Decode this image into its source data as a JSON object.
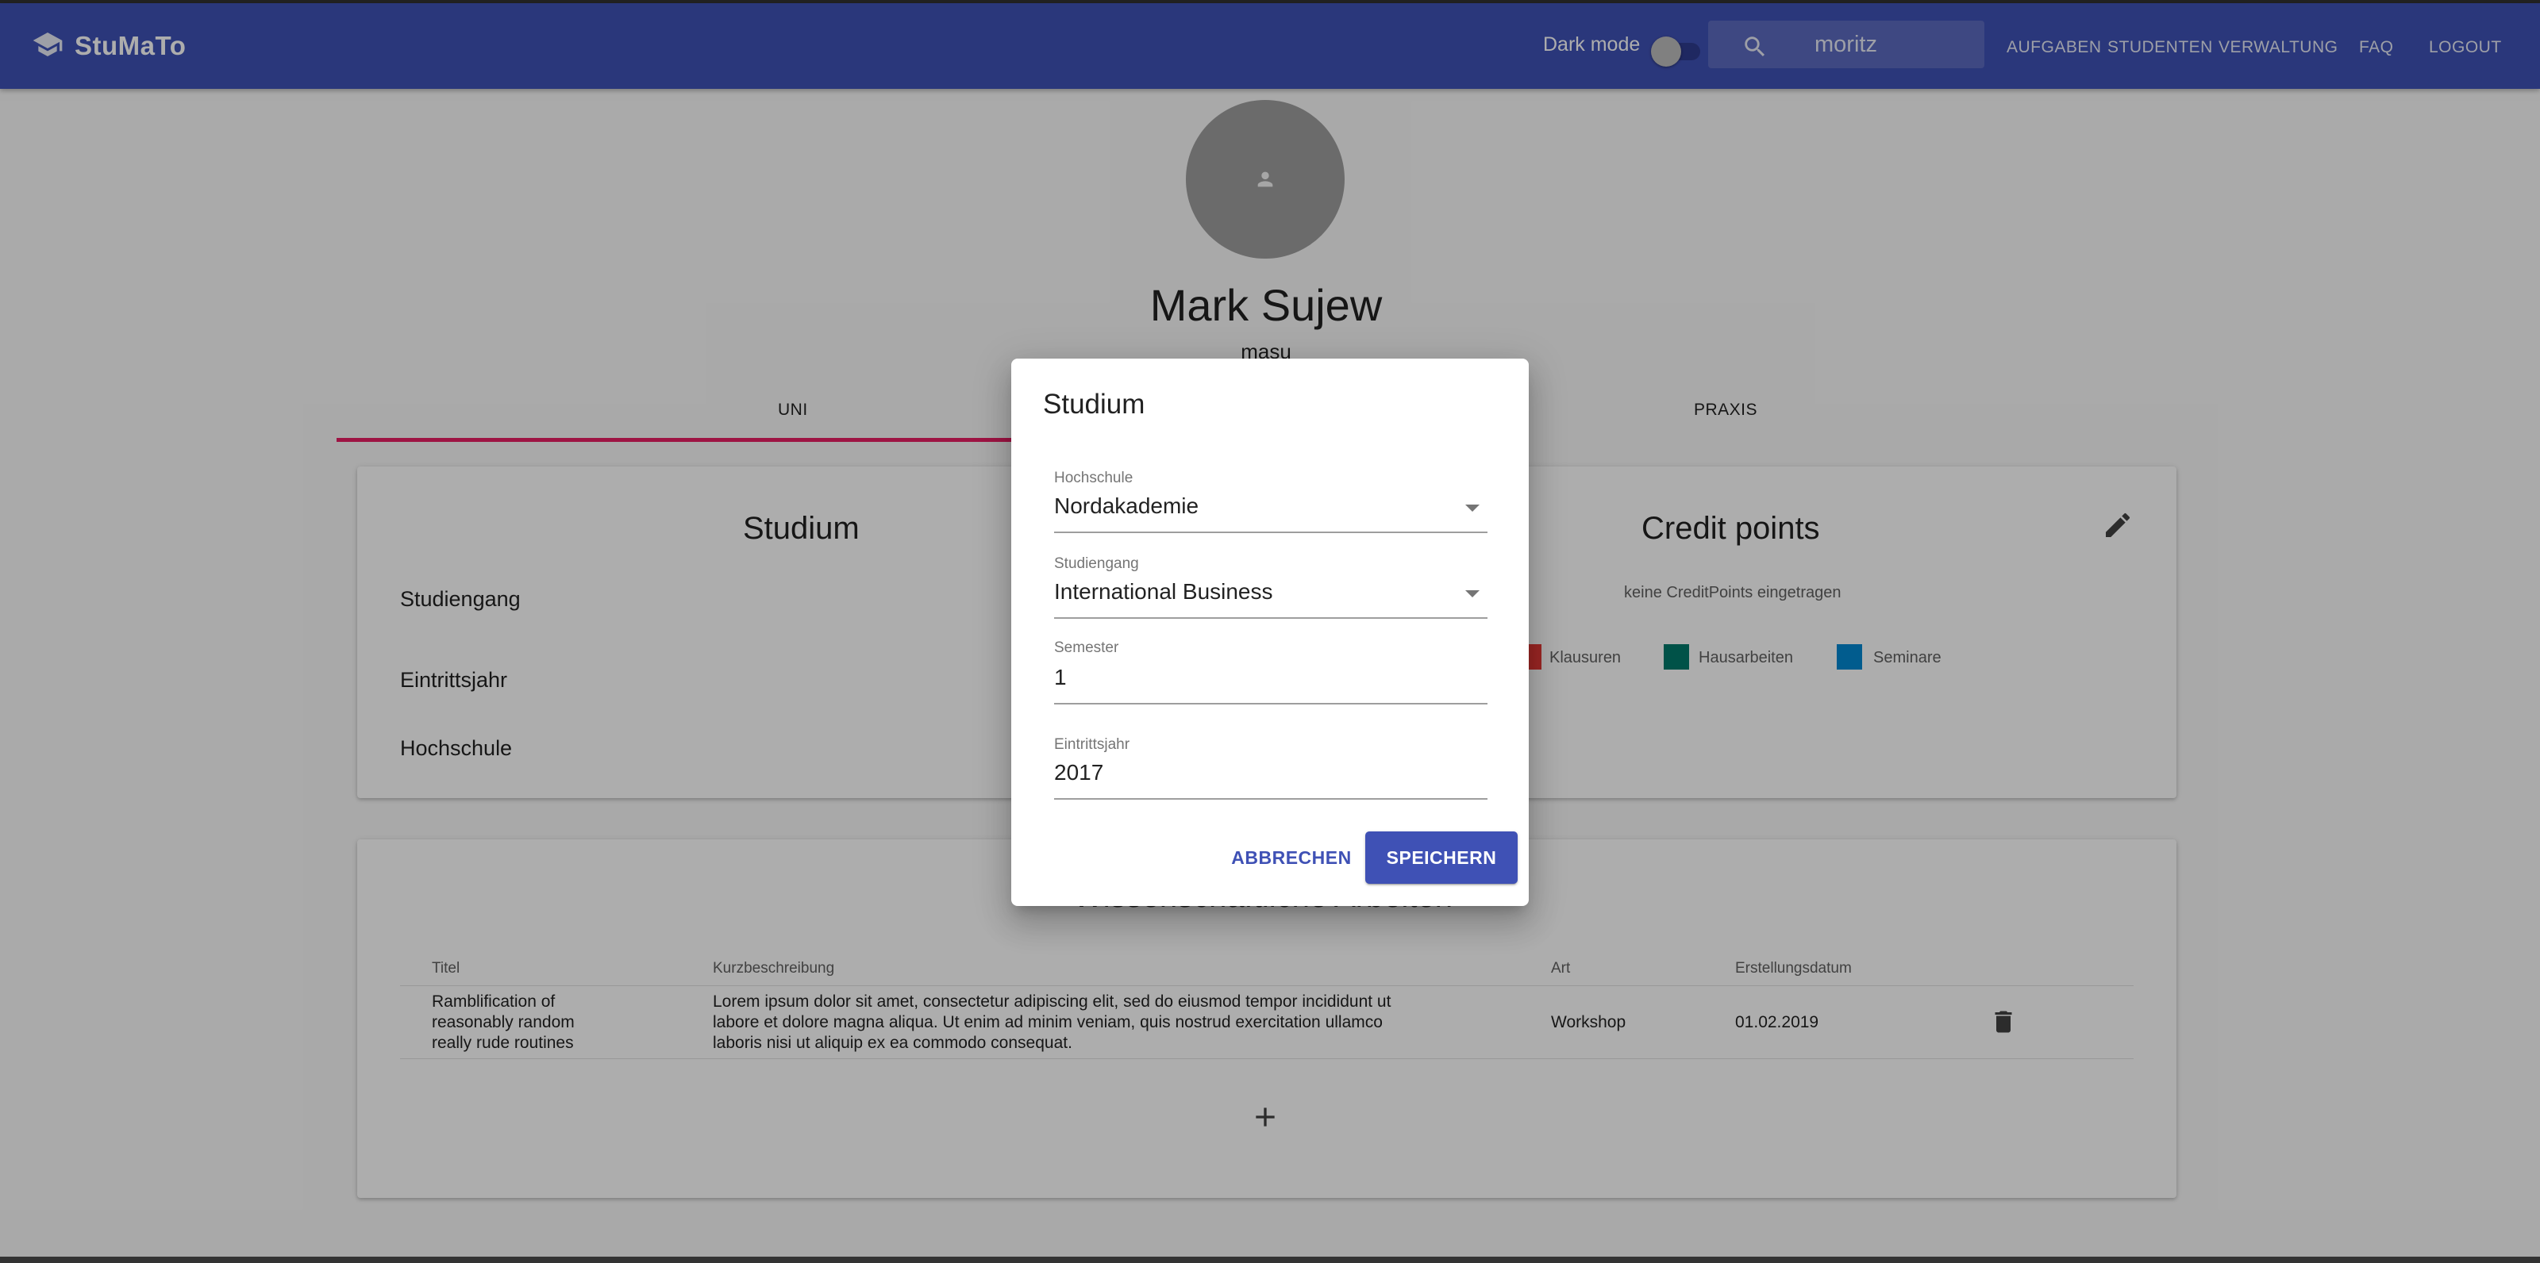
{
  "app": {
    "name": "StuMaTo"
  },
  "header": {
    "dark_mode_label": "Dark mode",
    "search_value": "moritz",
    "nav": [
      "AUFGABEN",
      "STUDENTEN",
      "VERWALTUNG",
      "FAQ",
      "LOGOUT"
    ]
  },
  "profile": {
    "name": "Mark Sujew",
    "username": "masu"
  },
  "tabs": {
    "uni": "UNI",
    "praxis": "PRAXIS"
  },
  "studium_card": {
    "title": "Studium",
    "labels": {
      "studiengang": "Studiengang",
      "eintrittsjahr": "Eintrittsjahr",
      "hochschule": "Hochschule"
    }
  },
  "credit_card": {
    "title": "Credit points",
    "empty": "keine CreditPoints eingetragen",
    "legend": [
      {
        "label": "Klausuren",
        "color": "#e53935"
      },
      {
        "label": "Hausarbeiten",
        "color": "#00796b"
      },
      {
        "label": "Seminare",
        "color": "#0288d1"
      }
    ]
  },
  "works_card": {
    "title": "Wissenschaftliche Arbeiten",
    "columns": {
      "titel": "Titel",
      "kurz": "Kurzbeschreibung",
      "art": "Art",
      "datum": "Erstellungsdatum"
    },
    "rows": [
      {
        "titel": [
          "Ramblification of",
          "reasonably random",
          "really rude routines"
        ],
        "kurz": [
          "Lorem ipsum dolor sit amet, consectetur adipiscing elit, sed do eiusmod tempor incididunt ut",
          "labore et dolore magna aliqua. Ut enim ad minim veniam, quis nostrud exercitation ullamco",
          "laboris nisi ut aliquip ex ea commodo consequat."
        ],
        "art": "Workshop",
        "datum": "01.02.2019"
      }
    ]
  },
  "dialog": {
    "title": "Studium",
    "hochschule": {
      "label": "Hochschule",
      "value": "Nordakademie"
    },
    "studiengang": {
      "label": "Studiengang",
      "value": "International Business"
    },
    "semester": {
      "label": "Semester",
      "value": "1"
    },
    "eintrittsjahr": {
      "label": "Eintrittsjahr",
      "value": "2017"
    },
    "cancel": "ABBRECHEN",
    "save": "SPEICHERN"
  },
  "colors": {
    "primary": "#3f51b5",
    "accent": "#e91e63"
  }
}
